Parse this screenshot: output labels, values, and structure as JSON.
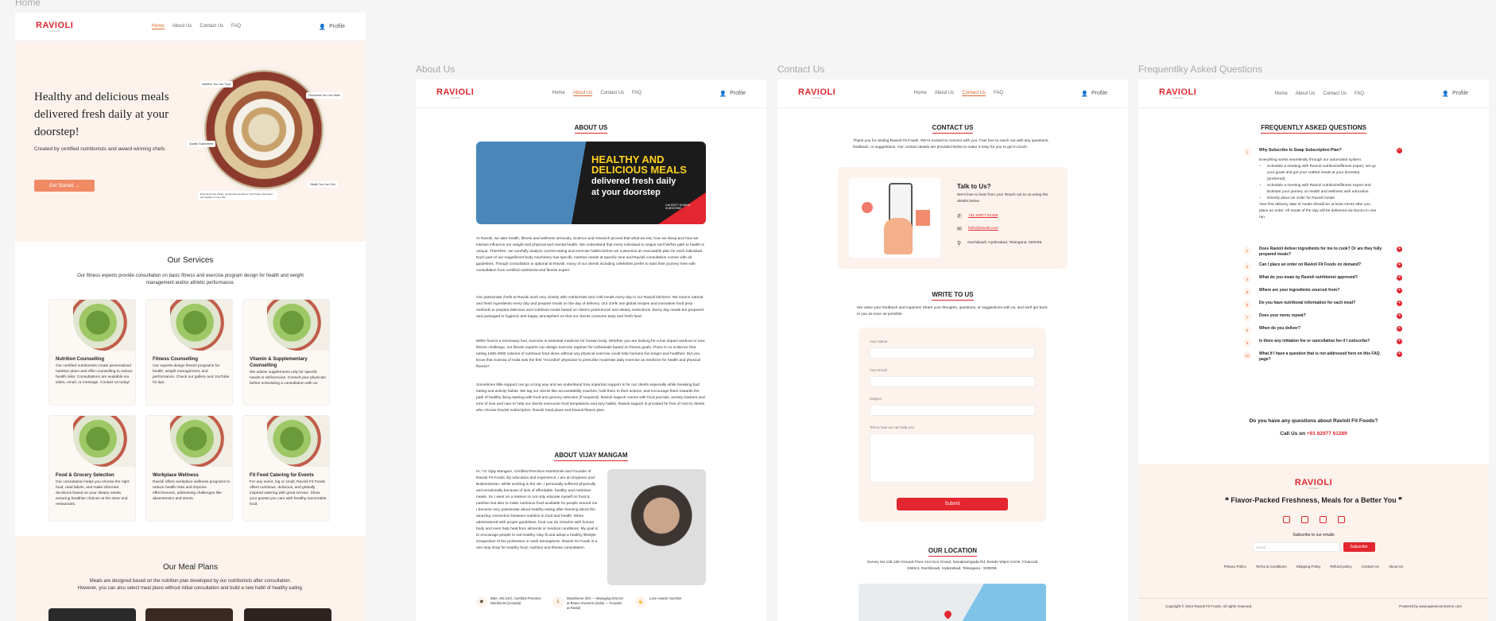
{
  "labels": {
    "home": "Home",
    "about": "About Us",
    "contact": "Contact Us",
    "faq": "Frequentlky Asked Questions"
  },
  "brand": {
    "name": "RAVIOLI",
    "tagline": "Fit Foods"
  },
  "nav": {
    "home": "Home",
    "about": "About Us",
    "contact": "Contact Us",
    "faq": "FAQ",
    "profile": "Profile"
  },
  "home": {
    "hero_title": "Healthy and delicious meals delivered fresh daily at your doorstep!",
    "hero_sub": "Created by certified nutritionists and award winning chefs.",
    "cta": "Get Started",
    "tags": [
      "Nutrition You Can Trust",
      "Freshness You Can Taste",
      "Quality Guaranteed",
      "Health You Can Feel"
    ],
    "tag_note": "Experience the vibrant, great-fresh goodness, that brings crisp flavor and quality to every bite.",
    "services_title": "Our Services",
    "services_sub": "Our fitness experts provide consultation on basic fitness and exercise program design for health and weight management and/or athletic performance.",
    "cards": [
      {
        "title": "Nutrition Counselling",
        "desc": "Our certified nutritionists create personalized nutrition plans and offer counselling to reduce health risks. Consultations are available via video, email, or message. Contact us today!"
      },
      {
        "title": "Fitness Counselling",
        "desc": "Our experts design fitness programs for health, weight management, and performance. Check our gallery and YouTube for tips."
      },
      {
        "title": "Vitamin & Supplementary Counselling",
        "desc": "We advise supplements only for specific needs or deficiencies. Consult your physician before scheduling a consultation with us."
      },
      {
        "title": "Food & Grocery Selection",
        "desc": "Our consultation helps you choose the right food, read labels, and make informed decisions based on your dietary needs, ensuring healthier choices at the store and restaurants."
      },
      {
        "title": "Workplace Wellness",
        "desc": "Ravioli offers workplace wellness programs to reduce health risks and improve effectiveness, addressing challenges like absenteeism and stress."
      },
      {
        "title": "Fit Food Catering for Events",
        "desc": "For any event, big or small, Ravioli Fit Foods offers nutritious, delicious, and globally inspired catering with great service. Show your guests you care with healthy memorable food."
      }
    ],
    "meal_title": "Our Meal Plans",
    "meal_sub1": "Meals are designed based on the nutrition plan developed by our nutritionists after consultation.",
    "meal_sub2": "However, you can also select meal plans without initial consultation and build a new habit of healthy eating."
  },
  "about": {
    "title": "ABOUT US",
    "banner_l1": "HEALTHY AND",
    "banner_l2": "DELICIOUS MEALS",
    "banner_l3": "delivered fresh daily",
    "banner_l4": "at your doorstep",
    "banner_call": "Call 82977 61289 to SUBSCRIBE",
    "p1": "At Ravioli, we take health, fitness and wellness seriously. Science and research proved that what we eat, how we sleep and how we interact influence our weight and physical and mental health. We understand that every individual is unique and his/her path to health is unique. Therefore, we carefully analyze current eating and exercise habits before we customize an executable plan for each individual. Each part of our magnificent body machinery has specific nutrition needs at specific time and Ravioli consultation comes with all guidelines. Though consultation is optional at Ravioli, many of our clients including celebrities prefer to start their journey here with consultation from certified nutritionist and fitness expert.",
    "p2": "Our passionate chefs at Ravioli work very closely with nutritionists and craft meals every day in our Ravioli kitchens. We source natural and fresh ingredients every day and prepare meals on the day of delivery. Our chefs use global recipes and innovative food prep methods to prepare delicious and nutritious meals based on client's preferences and dietary restrictions. Every day meals are prepared and packaged in hygienic and happy atmosphere so that our clients consume tasty and fresh food.",
    "p3": "While food is a necessary fuel, exercise is essential medicine for human body. Whether you are looking for a low impact workout or new fitness challenge, our fitness experts can design exercise regimen for individuals based on fitness goals. There is no evidence that eating 1500-2500 calories of nutritious food alone without any physical exercise could help humans live longer and healthier. Did you know that Susruta of India was the first \"recorded\" physician to prescribe moderate daily exercise as medicine for health and physical fitness?",
    "p4": "Sometimes little support can go a long way and we understand how important support is for our clients especially while breaking bad eating and activity habits. We tag our clients like accountability coaches, hold them to their actions, and encourage them towards the path of healthy living starting with food and grocery selection (if required). Ravioli support comes with food journals, activity trackers and tons of love and care to help our clients overcome food temptations and lazy habits. Ravioli support is provided for free of cost to clients who choose Ravioli subscription. Ravioli meal plans and Ravioli fitness plan.",
    "vijay_title": "ABOUT VIJAY MANGAM",
    "vijay_p": "Hi, I'm Vijay Mangam, Certified Precision Nutritionist and Founder of Ravioli Fit Foods. By education and experience, I am an Engineer and Businessman. While working in the UK, I personally suffered physically and emotionally because of lack of affordable, healthy and nutritious meals. So I went on a mission to not only educate myself on food & nutrition but also to make nutritious food available for people around me. I became very passionate about healthy eating after learning about the amazing connection between nutrition in food and health. When administered with proper guidelines, food can do miracles with human body and even help heal from ailments or medical conditions. My goal is to encourage people to eat healthy, stay fit and adopt a healthy lifestyle irrespective of the profession or work atmosphere. Ravioli Fit Foods is a one stop shop for healthy food, nutrition and fitness consultation.",
    "creds": [
      "MBA, MS (UK), Certified Precision Nutritionist (Canada)",
      "Marathoner (6X) — Managing Director at Bhanu Inverters (India) — Founder at Ravioli",
      "Love muscle machine"
    ]
  },
  "contact": {
    "title": "CONTACT US",
    "intro": "Thank you for visiting Ravioli Fit Foods. We're excited to connect with you. Feel free to reach out with any questions, feedback, or suggestions. Our contact details are provided below to make it easy for you to get in touch.",
    "talk_title": "Talk to Us?",
    "talk_sub": "We'd love to hear from you! Reach out to us using the details below.",
    "phone": "+91 82977 61289",
    "email": "hello@ravioli.com",
    "address": "Gachibowli, Hyderabad, Telangana, 500035.",
    "write_title": "WRITE TO US",
    "write_sub": "We value your feedback and inquiries! Share your thoughts, questions, or suggestions with us, and we'll get back to you as soon as possible.",
    "f_name": "Your Name",
    "f_email": "Your Email",
    "f_subject": "Subject",
    "f_msg": "Tell us how we can help you",
    "submit": "Submit",
    "loc_title": "OUR LOCATION",
    "loc_addr": "Survey No 135,136 Ground Floor Anvi Eco Grand, Nanakramguda Rd, beside Wipro Circle, Financial District, Gachibowli, Hyderabad, Telangana - 500008."
  },
  "faq": {
    "title": "FREQUENTLY ASKED QUESTIONS",
    "q1": "Why Subscribe to Swap Subscription Plan?",
    "a1": "Everything works seamlessly through our automated system.",
    "a1_bullets": [
      "Schedule a meeting with Ravioli nutritionist/fitness expert, set up your goals and get your crafted meals at your doorstep (preferred)",
      "Schedule a meeting with Ravioli nutritionist/fitness expert and kickstart your journey on health and wellness with education.",
      "Directly place an order for Ravioli meals"
    ],
    "a1_end": "Your first delivery date of meals should be at least 24Hrs after you place an order. All meals of the day will be delivered via Dunzo in one run.",
    "questions": [
      "Does Ravioli deliver ingredients for me to cook? Or are they fully prepared meals?",
      "Can I place an order on Ravioli Fit Foods on demand?",
      "What do you mean by Ravioli nutritionist approved?",
      "Where are your ingredients sourced from?",
      "Do you have nutritional information for each meal?",
      "Does your menu repeat?",
      "When do you deliver?",
      "Is there any initiation fee or cancellation fee if I subscribe?",
      "What if I have a question that is not addressed here on this FAQ page?"
    ],
    "nums": [
      "1",
      "2",
      "3",
      "4",
      "5",
      "6",
      "7",
      "8",
      "9",
      "10"
    ],
    "more": "Do you have any questions about Ravioli Fit Foods?",
    "call": "Call Us on",
    "call_num": "+91 82977 61289"
  },
  "footer": {
    "quote": "Flavor-Packed Freshness, Meals for a Better You",
    "subscribe": "Subscribe to our emails",
    "email_ph": "Email",
    "sub_btn": "Subscribe",
    "links": [
      "Privacy Policy",
      "Terms & Conditions",
      "Shipping Policy",
      "Refund policy",
      "Contact Us",
      "About Us"
    ],
    "copy": "Copyright © 2024 Ravioli Fit Foods. All rights reserved.",
    "powered": "Powered by www.apexecommerce.com"
  },
  "colors": {
    "accent": "#e3262f",
    "orange": "#e26a2c",
    "cream": "#fdf3ec"
  }
}
